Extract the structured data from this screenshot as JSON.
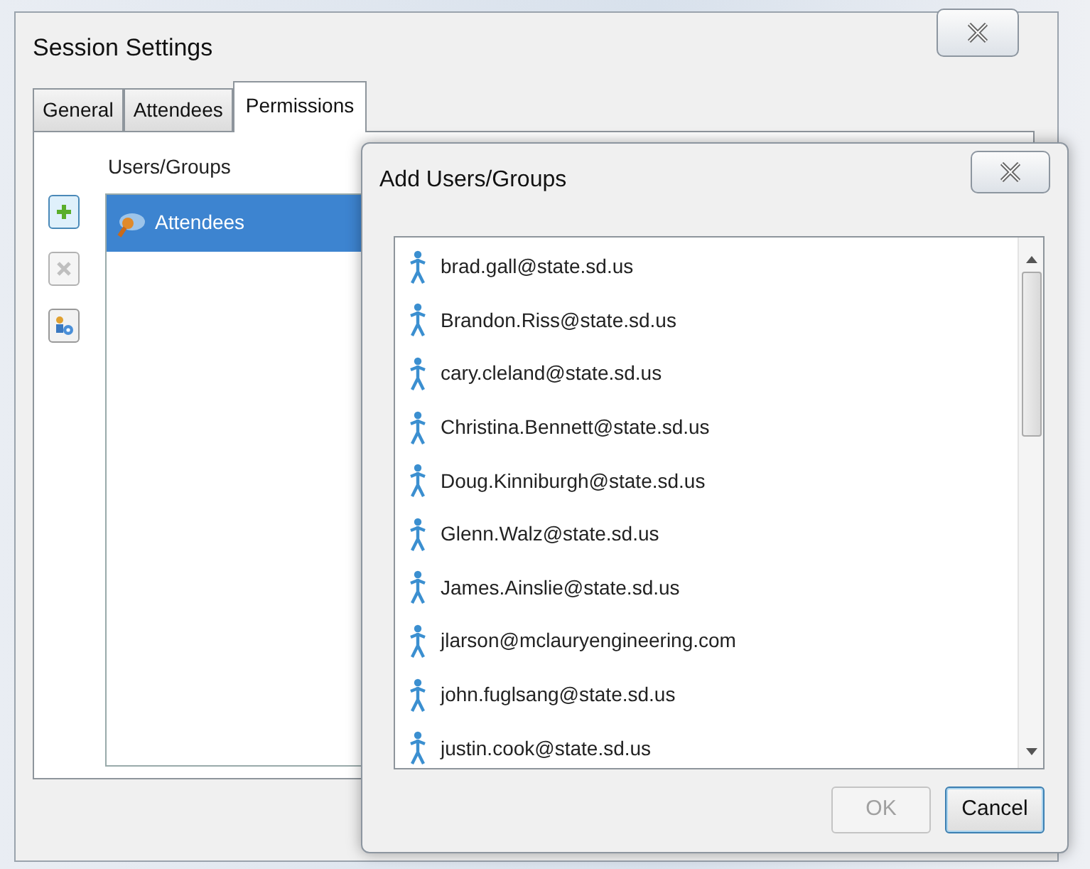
{
  "window": {
    "title": "Session Settings"
  },
  "tabs": [
    {
      "label": "General",
      "selected": false
    },
    {
      "label": "Attendees",
      "selected": false
    },
    {
      "label": "Permissions",
      "selected": true
    }
  ],
  "permissions": {
    "heading": "Users/Groups",
    "toolbar": [
      {
        "kind": "add",
        "disabled": false
      },
      {
        "kind": "remove",
        "disabled": true
      },
      {
        "kind": "properties",
        "disabled": false
      }
    ],
    "items": [
      {
        "label": "Attendees",
        "selected": true
      }
    ]
  },
  "dialog": {
    "title": "Add Users/Groups",
    "users": [
      {
        "label": "brad.gall@state.sd.us",
        "selected": false
      },
      {
        "label": "Brandon.Riss@state.sd.us",
        "selected": false
      },
      {
        "label": "cary.cleland@state.sd.us",
        "selected": false
      },
      {
        "label": "Christina.Bennett@state.sd.us",
        "selected": false
      },
      {
        "label": "Doug.Kinniburgh@state.sd.us",
        "selected": false
      },
      {
        "label": "Glenn.Walz@state.sd.us",
        "selected": false
      },
      {
        "label": "James.Ainslie@state.sd.us",
        "selected": false
      },
      {
        "label": "jlarson@mclauryengineering.com",
        "selected": false
      },
      {
        "label": "john.fuglsang@state.sd.us",
        "selected": false
      },
      {
        "label": "justin.cook@state.sd.us",
        "selected": false
      }
    ],
    "buttons": [
      {
        "label": "OK",
        "disabled": true
      },
      {
        "label": "Cancel",
        "disabled": false
      }
    ]
  }
}
